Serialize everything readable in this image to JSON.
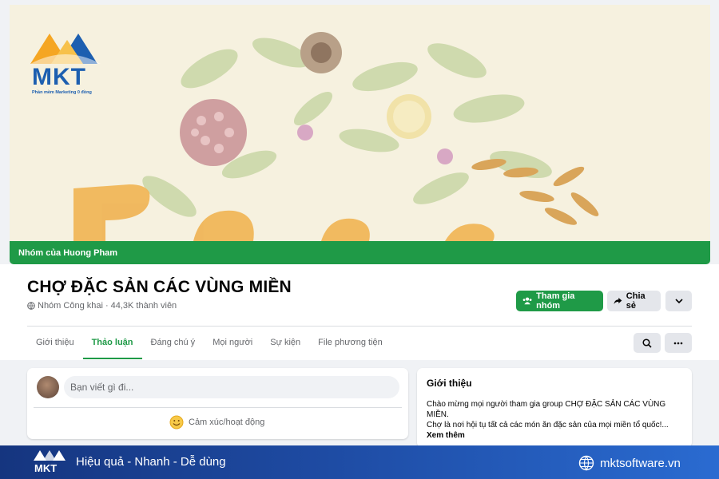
{
  "logo": {
    "brand": "MKT",
    "tagline": "Phần mềm Marketing 0 đồng"
  },
  "cover": {
    "owner_banner": "Nhóm của Huong Pham"
  },
  "group": {
    "title": "CHỢ ĐẶC SẢN CÁC VÙNG MIỀN",
    "privacy": "Nhóm Công khai",
    "separator": "·",
    "members": "44,3K thành viên"
  },
  "actions": {
    "join_label": "Tham gia nhóm",
    "share_label": "Chia sẻ"
  },
  "tabs": [
    {
      "label": "Giới thiệu"
    },
    {
      "label": "Thảo luận",
      "active": true
    },
    {
      "label": "Đáng chú ý"
    },
    {
      "label": "Mọi người"
    },
    {
      "label": "Sự kiện"
    },
    {
      "label": "File phương tiện"
    }
  ],
  "composer": {
    "placeholder": "Bạn viết gì đi...",
    "feeling_label": "Cảm xúc/hoạt động"
  },
  "about": {
    "heading": "Giới thiệu",
    "line1": "Chào mừng mọi người tham gia group CHỢ ĐẶC SẢN CÁC VÙNG MIỀN.",
    "line2": "Chợ là nơi hội tụ tất cả các món ăn đặc sản của mọi miền tổ quốc!...",
    "see_more": "Xem thêm"
  },
  "footer": {
    "slogan": "Hiệu quả - Nhanh - Dễ dùng",
    "website": "mktsoftware.vn"
  },
  "colors": {
    "accent_green": "#1f9a47",
    "footer_blue": "#1e4ba3",
    "logo_blue": "#1d5fb0",
    "logo_orange": "#f5a623"
  },
  "icons": [
    "globe-icon",
    "group-icon",
    "share-icon",
    "chevron-down-icon",
    "search-icon",
    "more-icon",
    "smiley-icon",
    "web-globe-icon"
  ]
}
